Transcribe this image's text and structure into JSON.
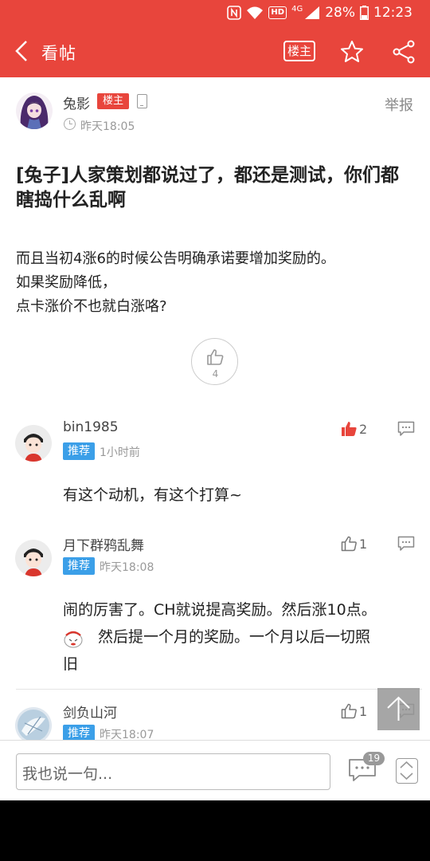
{
  "status_bar": {
    "hd": "HD",
    "network": "4G",
    "battery": "28%",
    "time": "12:23"
  },
  "header": {
    "title": "看帖",
    "op_only_label": "楼主"
  },
  "post": {
    "author": "兔影",
    "op_badge": "楼主",
    "time": "昨天18:05",
    "report_label": "举报",
    "title": "[兔子]人家策划都说过了，都还是测试，你们都瞎捣什么乱啊",
    "body_lines": [
      "而且当初4涨6的时候公告明确承诺要增加奖励的。",
      "如果奖励降低，",
      "点卡涨价不也就白涨咯?"
    ],
    "like_count": "4"
  },
  "comments": [
    {
      "author": "bin1985",
      "tag": "推荐",
      "time": "1小时前",
      "likes": "2",
      "liked": true,
      "text_lines": [
        "有这个动机，有这个打算~"
      ]
    },
    {
      "author": "月下群鸦乱舞",
      "tag": "推荐",
      "time": "昨天18:08",
      "likes": "1",
      "liked": false,
      "text_lines": [
        "闹的厉害了。CH就说提高奖励。然后涨10点。",
        "然后提一个月的奖励。一个月以后一切照",
        "旧"
      ]
    },
    {
      "author": "剑负山河",
      "tag": "推荐",
      "time": "昨天18:07",
      "likes": "1",
      "liked": false,
      "text_lines": []
    }
  ],
  "bottom_bar": {
    "reply_placeholder": "我也说一句...",
    "comment_count": "19"
  },
  "colors": {
    "brand_red": "#e8453c",
    "tag_blue": "#3b9fe8"
  }
}
